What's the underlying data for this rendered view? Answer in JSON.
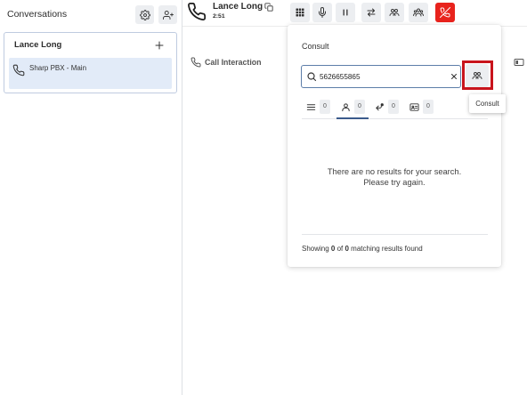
{
  "colors": {
    "text": "#2b2b2b",
    "selected_item_bg": "#e2ebf8",
    "button_bg": "#eceef1",
    "accent": "#3b5b8c",
    "hangup": "#e8231d",
    "annotation": "#c8141c"
  },
  "sidebar": {
    "title": "Conversations",
    "header_icons": [
      "gear-icon",
      "add-person-icon"
    ],
    "conversation": {
      "name": "Lance Long",
      "add_icon": "plus-icon",
      "items": [
        {
          "icon": "phone-icon",
          "label": "Sharp PBX - Main",
          "selected": true
        }
      ]
    }
  },
  "call_header": {
    "icon": "phone-icon",
    "caller_name": "Lance Long",
    "copy_icon": "copy-icon",
    "timer": "2:51"
  },
  "call_controls": [
    {
      "icon": "dialpad-icon"
    },
    {
      "icon": "mic-icon"
    },
    {
      "icon": "pause-icon"
    },
    {
      "icon": "transfer-icon"
    },
    {
      "icon": "consult-icon"
    },
    {
      "icon": "conference-icon"
    },
    {
      "icon": "hangup-icon"
    }
  ],
  "interaction": {
    "icon": "phone-icon",
    "title": "Call Interaction",
    "panel_toggle_icon": "side-panel-icon"
  },
  "consult_panel": {
    "title": "Consult",
    "search": {
      "icon": "search-icon",
      "value": "5626655865",
      "clear_icon": "close-icon"
    },
    "consult_button": {
      "icon": "consult-icon",
      "tooltip": "Consult"
    },
    "tabs": [
      {
        "icon": "list-icon",
        "count": "0",
        "active": false
      },
      {
        "icon": "person-icon",
        "count": "0",
        "active": true
      },
      {
        "icon": "queue-icon",
        "count": "0",
        "active": false
      },
      {
        "icon": "contact-card-icon",
        "count": "0",
        "active": false
      }
    ],
    "empty_message": [
      "There are no results for your search.",
      "Please try again."
    ],
    "summary": {
      "prefix": "Showing ",
      "shown": "0",
      "middle": " of ",
      "total": "0",
      "suffix": " matching results found"
    }
  }
}
